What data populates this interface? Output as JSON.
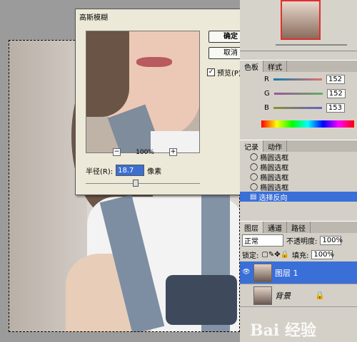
{
  "dialog": {
    "title": "高斯模糊",
    "ok_label": "确定",
    "cancel_label": "取消",
    "preview_label": "预览(P)",
    "preview_checked": "✓",
    "zoom_level": "100%",
    "zoom_out": "−",
    "zoom_in": "+",
    "radius_label": "半径(R):",
    "radius_value": "18.7",
    "radius_unit": "像素",
    "close": "×"
  },
  "color_panel": {
    "tabs": [
      "色板",
      "样式"
    ],
    "channels": [
      {
        "label": "R",
        "value": "152"
      },
      {
        "label": "G",
        "value": "152"
      },
      {
        "label": "B",
        "value": "153"
      }
    ]
  },
  "history_panel": {
    "tabs": [
      "记录",
      "动作"
    ],
    "items": [
      "椭圆选框",
      "椭圆选框",
      "椭圆选框",
      "椭圆选框",
      "选择反向"
    ]
  },
  "layers_panel": {
    "tabs": [
      "图层",
      "通道",
      "路径"
    ],
    "blend_mode": "正常",
    "opacity_label": "不透明度:",
    "opacity_value": "100%",
    "lock_label": "锁定:",
    "fill_label": "填充:",
    "fill_value": "100%",
    "layers": [
      {
        "name": "图层 1",
        "selected": true
      },
      {
        "name": "背景",
        "selected": false
      }
    ]
  },
  "watermark": "Bai 经验"
}
